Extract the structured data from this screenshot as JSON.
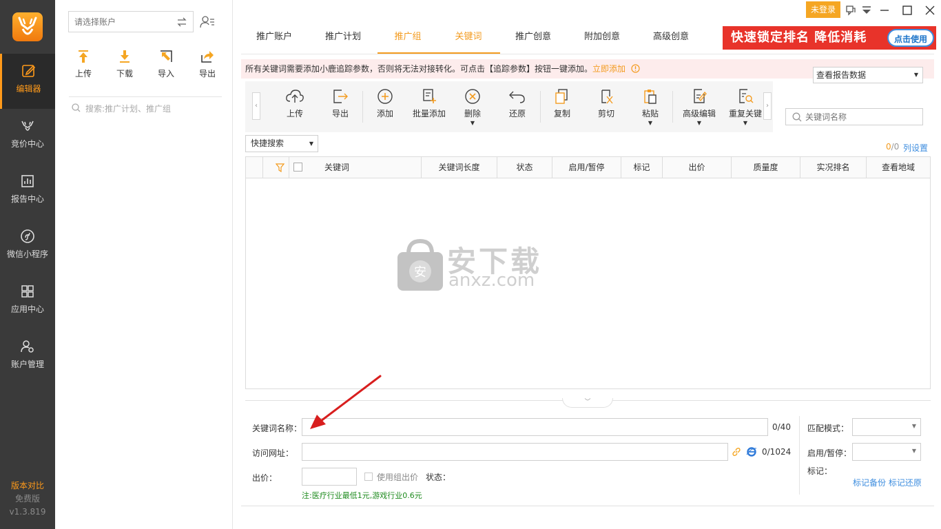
{
  "nav": {
    "items": [
      {
        "label": "编辑器",
        "icon": "edit-icon"
      },
      {
        "label": "竞价中心",
        "icon": "deer-icon"
      },
      {
        "label": "报告中心",
        "icon": "report-icon"
      },
      {
        "label": "微信小程序",
        "icon": "miniprogram-icon"
      },
      {
        "label": "应用中心",
        "icon": "apps-icon"
      },
      {
        "label": "账户管理",
        "icon": "account-gear-icon"
      }
    ],
    "version_compare": "版本对比",
    "edition": "免费版",
    "version": "v1.3.819"
  },
  "sidebar": {
    "account_placeholder": "请选择账户",
    "actions": [
      "上传",
      "下载",
      "导入",
      "导出"
    ],
    "search_placeholder": "搜索:推广计划、推广组"
  },
  "titlebar": {
    "login": "未登录"
  },
  "tabs": [
    "推广账户",
    "推广计划",
    "推广组",
    "关键词",
    "推广创意",
    "附加创意",
    "高级创意"
  ],
  "active_tabs": [
    "推广组",
    "关键词"
  ],
  "banner": {
    "text": "快速锁定排名 降低消耗",
    "button": "点击使用"
  },
  "notice": {
    "text": "所有关键词需要添加小鹿追踪参数，否则将无法对接转化。可点击【追踪参数】按钮一键添加。",
    "link": "立即添加"
  },
  "report_select": "查看报告数据",
  "toolbar": {
    "tools": [
      {
        "label": "上传",
        "icon": "upload-cloud-icon"
      },
      {
        "label": "导出",
        "icon": "export-icon"
      },
      {
        "label": "添加",
        "icon": "add-circle-icon"
      },
      {
        "label": "批量添加",
        "icon": "batch-add-icon"
      },
      {
        "label": "删除",
        "icon": "delete-circle-icon"
      },
      {
        "label": "还原",
        "icon": "undo-icon"
      },
      {
        "label": "复制",
        "icon": "copy-icon"
      },
      {
        "label": "剪切",
        "icon": "cut-icon"
      },
      {
        "label": "粘贴",
        "icon": "paste-icon"
      },
      {
        "label": "高级编辑",
        "icon": "advanced-edit-icon"
      },
      {
        "label": "重复关键",
        "icon": "duplicate-search-icon"
      }
    ]
  },
  "keyword_search_placeholder": "关键词名称",
  "quick_search": "快捷搜索",
  "count": {
    "selected": "0",
    "total": "/0"
  },
  "column_settings": "列设置",
  "grid": {
    "columns": [
      "关键词",
      "关键词长度",
      "状态",
      "启用/暂停",
      "标记",
      "出价",
      "质量度",
      "实况排名",
      "查看地域"
    ],
    "rows": []
  },
  "watermark": {
    "text": "安下载",
    "url": "anxz.com",
    "badge": "安"
  },
  "form": {
    "keyword_label": "关键词名称：",
    "keyword_count": "0/40",
    "url_label": "访问网址：",
    "url_count": "0/1024",
    "bid_label": "出价：",
    "use_group_bid": "使用组出价",
    "status_label": "状态：",
    "note": "注:医疗行业最低1元,游戏行业0.6元",
    "match_label": "匹配模式：",
    "enable_label": "启用/暂停：",
    "mark_label": "标记：",
    "mark_backup": "标记备份",
    "mark_restore": "标记还原"
  }
}
